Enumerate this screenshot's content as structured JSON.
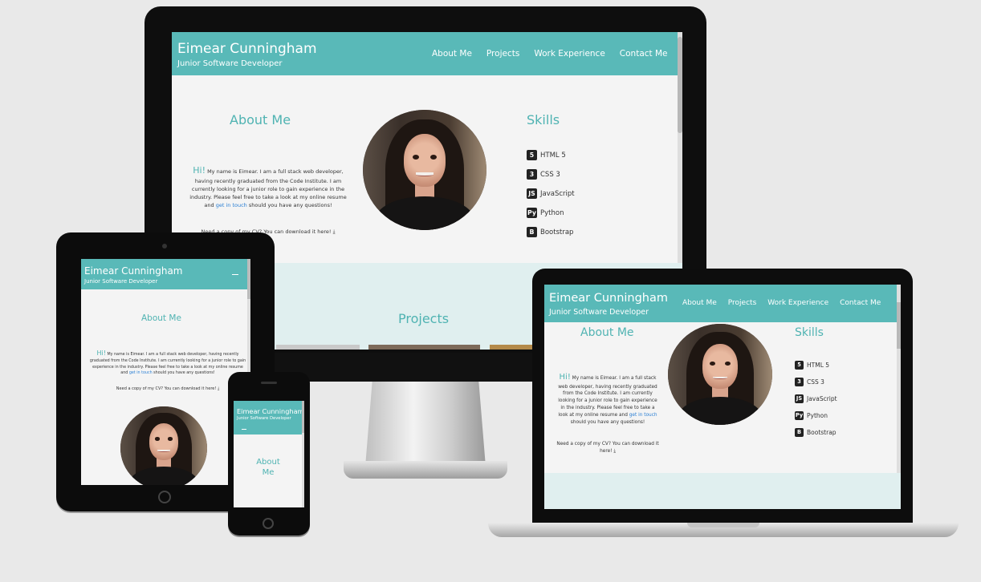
{
  "site": {
    "name": "Eimear Cunningham",
    "tagline": "Junior Software Developer",
    "nav": [
      "About Me",
      "Projects",
      "Work Experience",
      "Contact Me"
    ],
    "about": {
      "heading": "About Me",
      "hi": "Hi!",
      "body_a": " My name is Eimear. I am a full stack web developer, having recently graduated from the Code Institute. I am currently looking for a junior role to gain experience in the industry. Please feel free to take a look at my online resume and ",
      "link": "get in touch",
      "body_b": " should you have any questions!",
      "cv": "Need a copy of my CV? You can download it here!"
    },
    "skills": {
      "heading": "Skills",
      "items": [
        {
          "label": "HTML 5",
          "icon": "html5-icon",
          "glyph": "5"
        },
        {
          "label": "CSS 3",
          "icon": "css3-icon",
          "glyph": "3"
        },
        {
          "label": "JavaScript",
          "icon": "javascript-icon",
          "glyph": "JS"
        },
        {
          "label": "Python",
          "icon": "python-icon",
          "glyph": "Py"
        },
        {
          "label": "Bootstrap",
          "icon": "bootstrap-icon",
          "glyph": "B"
        }
      ]
    },
    "projects_heading": "Projects",
    "colors": {
      "accent": "#59b9b8",
      "link": "#2a7fd4"
    }
  },
  "mobile": {
    "about_line1": "About",
    "about_line2": "Me"
  }
}
